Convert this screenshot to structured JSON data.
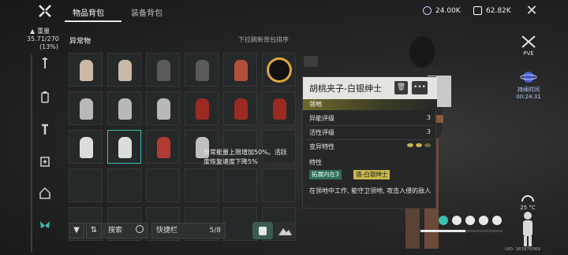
{
  "tabs": [
    {
      "label": "物品背包",
      "active": true
    },
    {
      "label": "装备背包",
      "active": false
    }
  ],
  "currency": [
    {
      "icon": "crystal-icon",
      "value": "24.00K"
    },
    {
      "icon": "chip-icon",
      "value": "62.82K"
    }
  ],
  "weight": {
    "label": "重量",
    "value": "35.71/270",
    "percent": "(13%)"
  },
  "inventory": {
    "section_title": "异常物",
    "sort_hint": "下拉刷新背包排序",
    "selected_index": 13,
    "item_icons": [
      "bear-plush-icon",
      "bear-plush-icon",
      "rabbit-doll-icon",
      "rabbit-doll-icon",
      "jester-doll-icon",
      "eclipse-ring-icon",
      "cat-statue-icon",
      "cat-statue-icon",
      "cat-statue-icon",
      "red-mask-icon",
      "red-mask-icon",
      "red-mask-icon",
      "white-rabbit-icon",
      "white-rabbit-icon",
      "nutcracker-icon",
      "nutcracker-silver-icon"
    ]
  },
  "toolbar": {
    "search_label": "搜索",
    "quickbar_label": "快捷栏",
    "quickbar_count": "5/8"
  },
  "tooltip": {
    "text": "异常能量上限增加50%。活跃度恢复速度下降5%"
  },
  "detail": {
    "title": "胡桃夹子-白银绅士",
    "category": "领地",
    "rows": [
      {
        "label": "异能评级",
        "value": "3"
      },
      {
        "label": "活性评级",
        "value": "3"
      },
      {
        "label": "变异特性",
        "value": ""
      }
    ],
    "traits_label": "特性",
    "tags": [
      "拓展内在3",
      "语-白银绅士"
    ],
    "description": "在领地中工作, 能守卫领地, 攻击入侵的敌人"
  },
  "hud": {
    "mode": "PVE",
    "timer_label": "持续时间",
    "timer_value": "00:24:31",
    "temperature": "25 °C",
    "uid": "UID: 161875069"
  },
  "colors": {
    "accent_teal": "#39c2b2",
    "tag_green": "#2f6d5a",
    "tag_yellow": "#c9b64a"
  }
}
